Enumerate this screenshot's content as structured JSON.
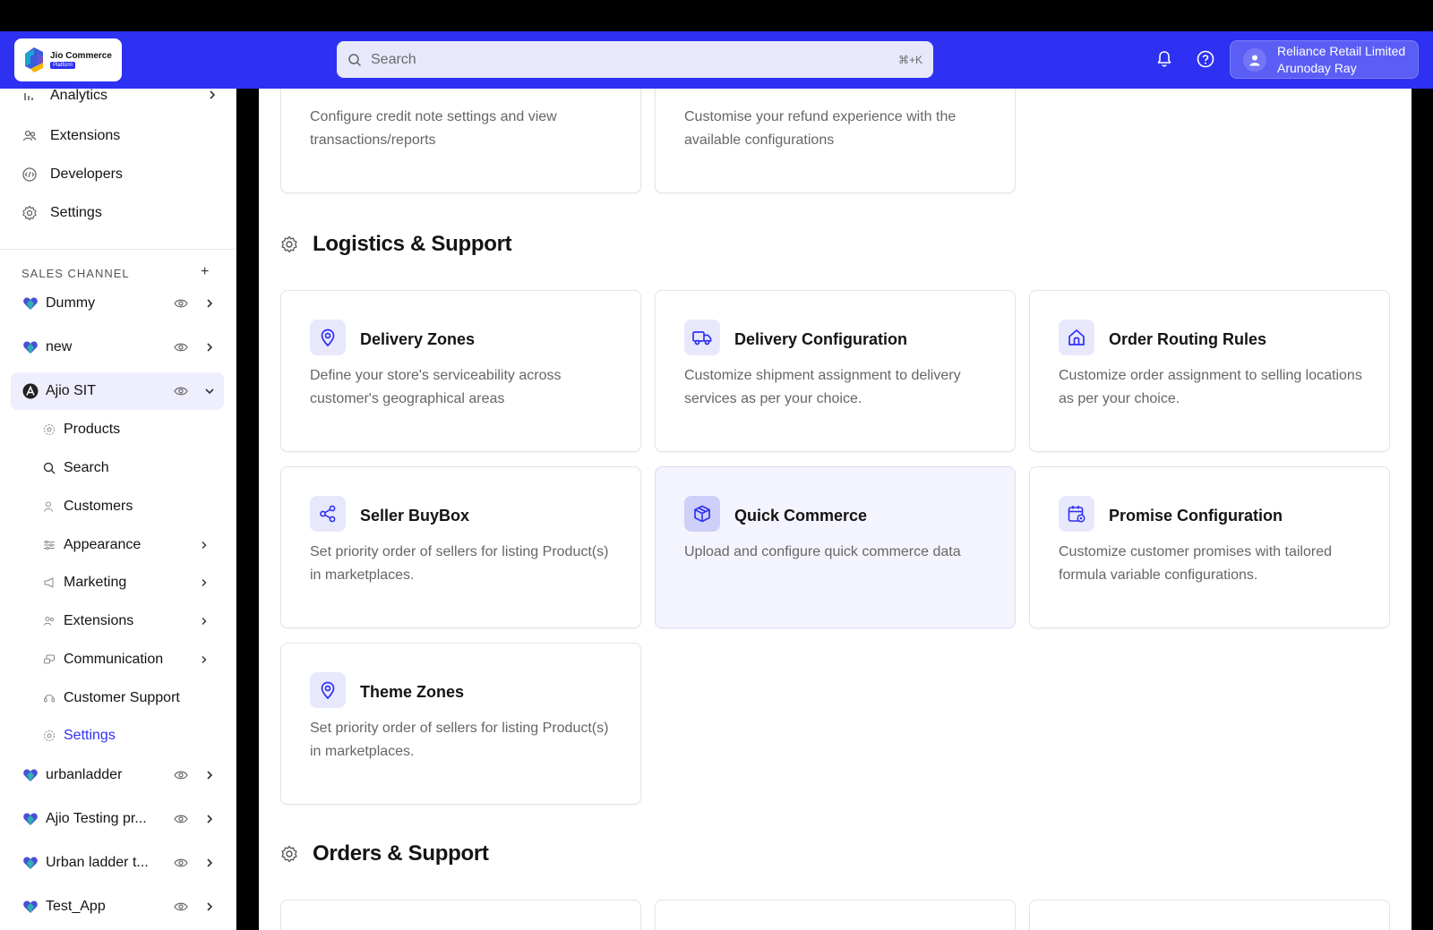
{
  "brand": {
    "name": "Jio Commerce",
    "badge": "Platform",
    "accent": "#2e31f1"
  },
  "header": {
    "search_placeholder": "Search",
    "search_shortcut": "⌘+K",
    "user_org": "Reliance Retail Limited",
    "user_name": "Arunoday Ray",
    "icons": [
      "bell-icon",
      "help-icon",
      "user-avatar-icon"
    ]
  },
  "sidebar": {
    "main_items": [
      {
        "label": "Analytics",
        "icon": "bar-chart-icon",
        "chevron": true
      },
      {
        "label": "Extensions",
        "icon": "extensions-icon",
        "chevron": false
      },
      {
        "label": "Developers",
        "icon": "developers-icon",
        "chevron": false
      },
      {
        "label": "Settings",
        "icon": "gear-icon",
        "chevron": false
      }
    ],
    "section_label": "SALES CHANNEL",
    "section_add": "+",
    "channels": [
      {
        "label": "Dummy",
        "expanded": false
      },
      {
        "label": "new",
        "expanded": false
      },
      {
        "label": "Ajio SIT",
        "expanded": true,
        "active": true
      },
      {
        "label": "urbanladder",
        "expanded": false
      },
      {
        "label": "Ajio Testing pr...",
        "expanded": false
      },
      {
        "label": "Urban ladder t...",
        "expanded": false
      },
      {
        "label": "Test_App",
        "expanded": false
      }
    ],
    "sub_items": [
      {
        "label": "Products",
        "icon": "gear-icon",
        "chevron": false
      },
      {
        "label": "Search",
        "icon": "search-icon",
        "chevron": false
      },
      {
        "label": "Customers",
        "icon": "customers-icon",
        "chevron": false
      },
      {
        "label": "Appearance",
        "icon": "sliders-icon",
        "chevron": true
      },
      {
        "label": "Marketing",
        "icon": "megaphone-icon",
        "chevron": true
      },
      {
        "label": "Extensions",
        "icon": "extensions-icon",
        "chevron": true
      },
      {
        "label": "Communication",
        "icon": "chat-icon",
        "chevron": true
      },
      {
        "label": "Customer Support",
        "icon": "headset-icon",
        "chevron": false
      },
      {
        "label": "Settings",
        "icon": "gear-icon",
        "chevron": false,
        "active": true
      }
    ]
  },
  "content": {
    "top_cards": [
      {
        "desc": "Configure credit note settings and view transactions/reports"
      },
      {
        "desc": "Customise your refund experience with the available configurations"
      }
    ],
    "section_logistics": "Logistics & Support",
    "logistics_cards": [
      {
        "title": "Delivery Zones",
        "desc": "Define your store's serviceability across customer's geographical areas",
        "icon": "map-pin-icon"
      },
      {
        "title": "Delivery Configuration",
        "desc": "Customize shipment assignment to delivery services as per your choice.",
        "icon": "truck-icon"
      },
      {
        "title": "Order Routing Rules",
        "desc": "Customize order assignment to selling locations as per your choice.",
        "icon": "store-icon"
      },
      {
        "title": "Seller BuyBox",
        "desc": "Set priority order of sellers for listing Product(s) in marketplaces.",
        "icon": "share-icon"
      },
      {
        "title": "Quick Commerce",
        "desc": "Upload and configure quick commerce data",
        "icon": "box-icon"
      },
      {
        "title": "Promise Configuration",
        "desc": "Customize customer promises with tailored formula variable configurations.",
        "icon": "calendar-settings-icon"
      },
      {
        "title": "Theme Zones",
        "desc": "Set priority order of sellers for listing Product(s) in marketplaces.",
        "icon": "map-pin-icon"
      }
    ],
    "section_orders": "Orders & Support"
  }
}
